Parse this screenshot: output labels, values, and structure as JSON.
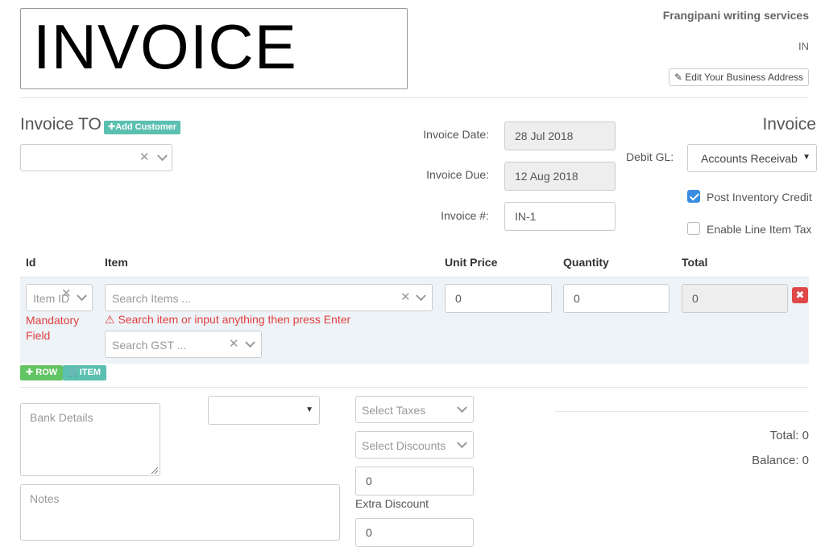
{
  "logo": {
    "text": "INVOICE"
  },
  "business": {
    "name": "Frangipani writing services",
    "country": "IN",
    "edit_address_label": "Edit Your Business Address"
  },
  "customer": {
    "heading": "Invoice TO",
    "add_customer_label": "Add Customer",
    "selected": ""
  },
  "dates": {
    "invoice_date_label": "Invoice Date:",
    "invoice_date_value": "28 Jul 2018",
    "invoice_due_label": "Invoice Due:",
    "invoice_due_value": "12 Aug 2018",
    "invoice_number_label": "Invoice #:",
    "invoice_number_value": "IN-1"
  },
  "settings": {
    "heading": "Invoice",
    "debit_gl_label": "Debit GL:",
    "debit_gl_value": "Accounts Receivab",
    "post_inventory_credit_label": "Post Inventory Credit",
    "post_inventory_credit_checked": true,
    "enable_line_item_tax_label": "Enable Line Item Tax",
    "enable_line_item_tax_checked": false
  },
  "table": {
    "headers": [
      "Id",
      "Item",
      "Unit Price",
      "Quantity",
      "Total"
    ],
    "row": {
      "item_id_placeholder": "Item ID",
      "item_search_placeholder": "Search Items ...",
      "mandatory_line1": "Mandatory",
      "mandatory_line2": "Field",
      "item_hint": "Search item or input anything then press Enter",
      "gst_placeholder": "Search GST ...",
      "unit_price": "0",
      "quantity": "0",
      "total": "0"
    }
  },
  "actions": {
    "add_row_label": "ROW",
    "add_item_label": "ITEM"
  },
  "footer": {
    "bank_details_placeholder": "Bank Details",
    "notes_placeholder": "Notes",
    "currency_select_value": "",
    "select_taxes_placeholder": "Select Taxes",
    "select_discounts_placeholder": "Select Discounts",
    "discount_value": "0",
    "extra_discount_label": "Extra Discount",
    "extra_discount_value": "0",
    "total_label": "Total: 0",
    "balance_label": "Balance: 0"
  },
  "colors": {
    "add_customer": "#5bc0b0",
    "add_row": "#62c462",
    "add_item": "#5bc0b0",
    "delete": "#e04848",
    "checkbox_on": "#3a8de0",
    "error": "#e04040"
  }
}
